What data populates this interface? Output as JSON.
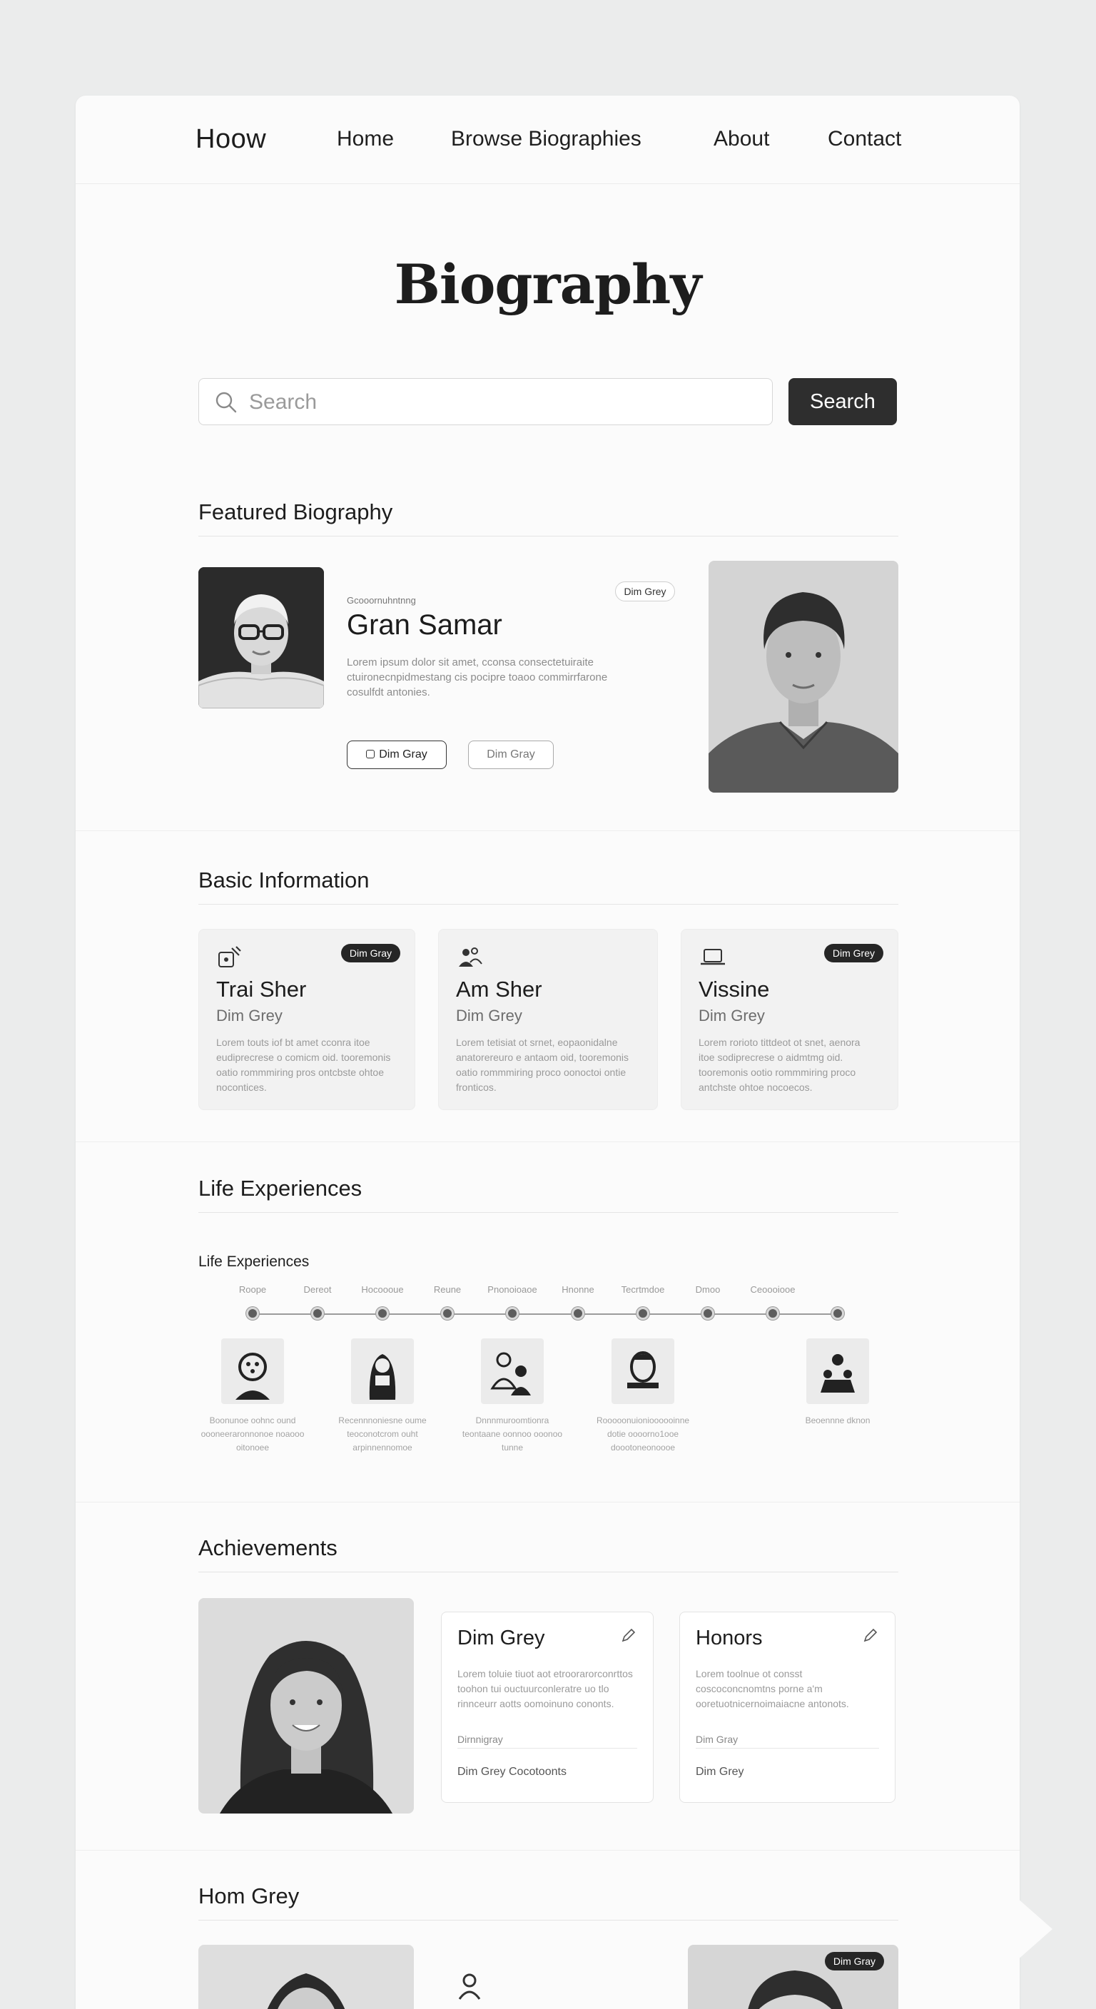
{
  "header": {
    "logo": "Hoow",
    "nav": [
      "Home",
      "Browse Biographies",
      "About",
      "Contact"
    ]
  },
  "hero": {
    "title": "Biography",
    "search_placeholder": "Search",
    "search_button": "Search"
  },
  "featured": {
    "section_title": "Featured Biography",
    "eyebrow": "Gcooornuhntnng",
    "name": "Gran Samar",
    "badge": "Dim Grey",
    "description": "Lorem ipsum dolor sit amet, cconsa consectetuiraite ctuironecnpidmestang cis pocipre toaoo commirrfarone cosulfdt antonies.",
    "button_primary": "Dim Gray",
    "button_secondary": "Dim Gray"
  },
  "basic_info": {
    "section_title": "Basic Information",
    "cards": [
      {
        "title": "Trai Sher",
        "subtitle": "Dim Grey",
        "badge": "Dim Gray",
        "icon": "tools-icon",
        "text": "Lorem touts iof bt amet cconra itoe eudiprecrese o comicm oid. tooremonis oatio rommmiring pros ontcbste ohtoe nocontices."
      },
      {
        "title": "Am Sher",
        "subtitle": "Dim Grey",
        "badge": "",
        "icon": "people-icon",
        "text": "Lorem tetisiat ot srnet, eopaonidalne anatorereuro e antaom oid, tooremonis oatio rommmiring proco oonoctoi ontie fronticos."
      },
      {
        "title": "Vissine",
        "subtitle": "Dim Grey",
        "badge": "Dim Grey",
        "icon": "laptop-icon",
        "text": "Lorem rorioto tittdeot ot snet, aenora itoe sodiprecrese o aidmtmg oid. tooremonis ootio rommmiring proco antchste ohtoe nocoecos."
      }
    ]
  },
  "life": {
    "section_title": "Life Experiences",
    "subtitle": "Life Experiences",
    "labels": [
      "Roope",
      "Dereot",
      "Hocoooue",
      "Reune",
      "Pnonoioaoe",
      "Hnonne",
      "Tecrtmdoe",
      "Dmoo",
      "Ceoooiooe"
    ],
    "events": [
      {
        "icon": "face-icon",
        "caption": "Boonunoe oohnc ound oooneeraronnonoe noaooo oitonoee"
      },
      {
        "icon": "speaker-icon",
        "caption": "Recennnoniesne oume teoconotcrom ouht arpinnennomoe"
      },
      {
        "icon": "couple-icon",
        "caption": "Dnnnmuroomtionra teontaane oonnoo ooonoo tunne"
      },
      {
        "icon": "portrait-icon",
        "caption": "Rooooonuionioooooinne dotie oooorno1ooe doootoneonoooe"
      },
      {
        "icon": "group-icon",
        "caption": "Beoennne dknon"
      }
    ]
  },
  "achievements": {
    "section_title": "Achievements",
    "cards": [
      {
        "title": "Dim Grey",
        "text": "Lorem toluie tiuot aot etroorarorconrttos toohon tui ouctuurconleratre uo tlo rinnceurr aotts oomoinuno cononts.",
        "meta1": "Dirnnigray",
        "meta2": "Dim Grey Cocotoonts"
      },
      {
        "title": "Honors",
        "text": "Lorem toolnue ot consst coscoconcnomtns porne a'm ooretuotnicernoimaiacne antonots.",
        "meta1": "Dim Gray",
        "meta2": "Dim Grey"
      }
    ]
  },
  "more": {
    "section_title": "Hom Grey",
    "badge": "Dim Gray"
  }
}
